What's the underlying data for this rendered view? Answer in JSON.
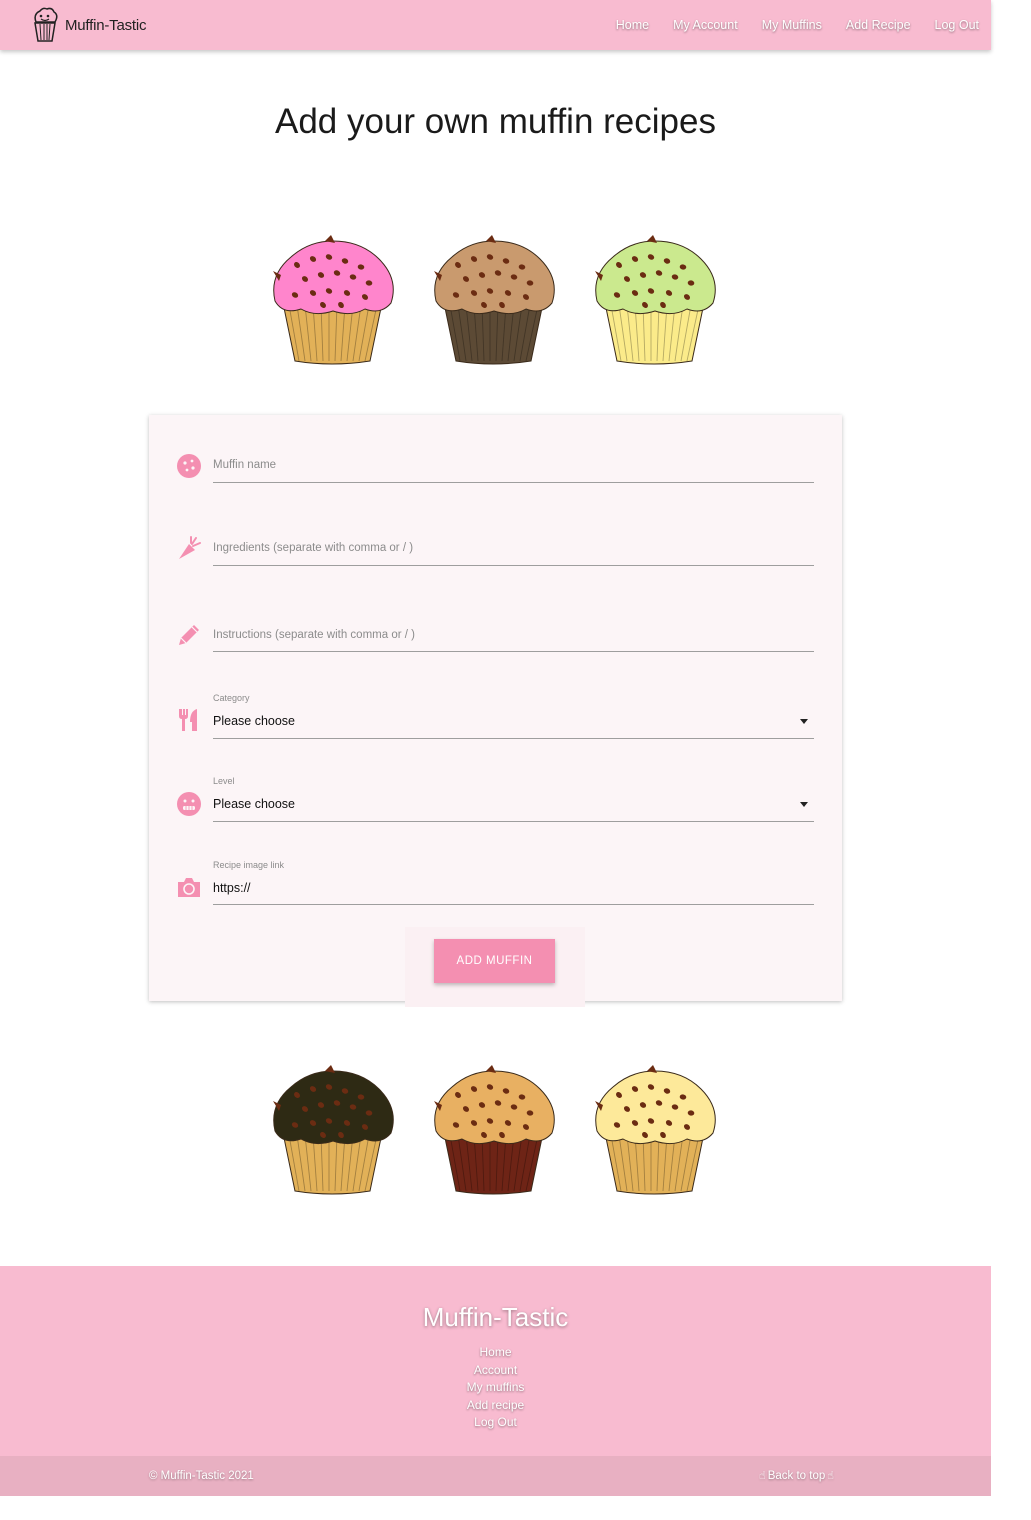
{
  "brand": {
    "name": "Muffin-Tastic"
  },
  "nav": {
    "links": [
      "Home",
      "My Account",
      "My Muffins",
      "Add Recipe",
      "Log Out"
    ]
  },
  "page": {
    "title": "Add your own muffin recipes"
  },
  "form": {
    "muffin_name": {
      "placeholder": "Muffin name",
      "icon": "cookie-icon"
    },
    "ingredients": {
      "placeholder": "Ingredients (separate with comma or / )",
      "icon": "carrot-icon"
    },
    "instructions": {
      "placeholder": "Instructions (separate with comma or / )",
      "icon": "pencil-icon"
    },
    "category": {
      "label": "Category",
      "selected": "Please choose",
      "icon": "utensils-icon"
    },
    "level": {
      "label": "Level",
      "selected": "Please choose",
      "icon": "grimace-face-icon"
    },
    "image_link": {
      "label": "Recipe image link",
      "value": "https://",
      "icon": "camera-icon"
    },
    "submit_label": "ADD MUFFIN"
  },
  "footer": {
    "title": "Muffin-Tastic",
    "links": [
      "Home",
      "Account",
      "My muffins",
      "Add recipe",
      "Log Out"
    ],
    "copyright": "© Muffin-Tastic 2021",
    "back_to_top": "Back to top"
  },
  "colors": {
    "nav_bg": "#f8bbd0",
    "accent": "#f48fb1",
    "card_bg": "#fcf5f7",
    "copy_bar": "#e8b0c2"
  },
  "muffins": {
    "top": [
      {
        "frosting": "#ff85cc",
        "wrapper": "#e2b158"
      },
      {
        "frosting": "#c99a6e",
        "wrapper": "#5c4a35"
      },
      {
        "frosting": "#cbe98e",
        "wrapper": "#fbeb8a"
      }
    ],
    "bottom": [
      {
        "frosting": "#2e2a14",
        "wrapper": "#e2b158"
      },
      {
        "frosting": "#e8b062",
        "wrapper": "#6e2416"
      },
      {
        "frosting": "#fde99a",
        "wrapper": "#e2b158"
      }
    ]
  }
}
